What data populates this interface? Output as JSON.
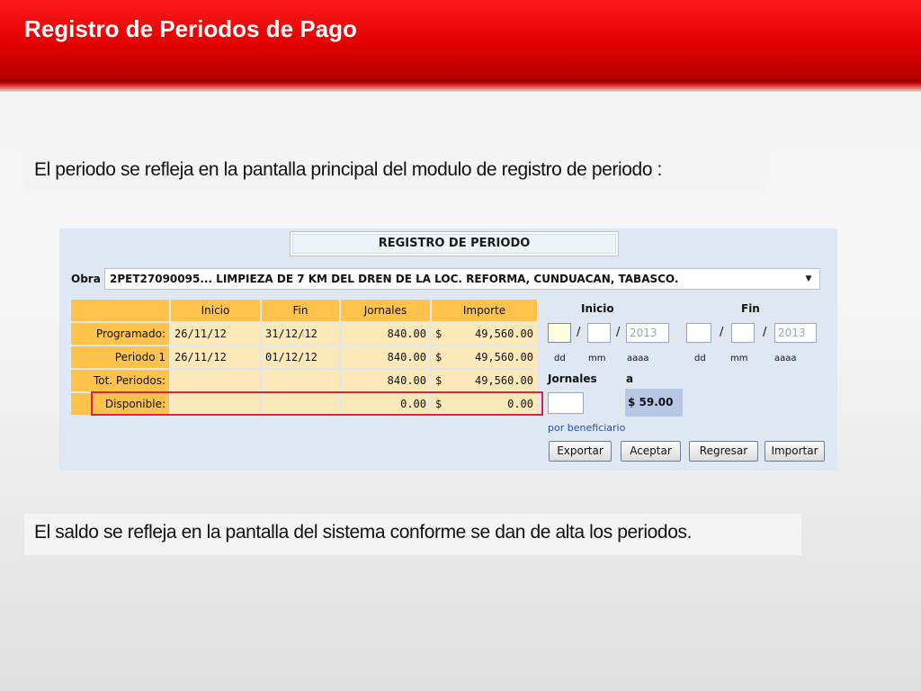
{
  "slide": {
    "title": "Registro de Periodos de Pago",
    "caption_top": "El periodo se refleja en la pantalla principal del modulo de registro de periodo :",
    "caption_bottom": "El saldo se refleja en la pantalla del sistema conforme se dan de alta los periodos."
  },
  "form": {
    "title": "REGISTRO DE PERIODO",
    "obra_label": "Obra",
    "obra_value": "2PET27090095... LIMPIEZA DE 7 KM DEL DREN DE LA LOC. REFORMA, CUNDUACAN, TABASCO.",
    "table": {
      "headers": [
        "Inicio",
        "Fin",
        "Jornales",
        "Importe"
      ],
      "rows": [
        {
          "label": "Programado:",
          "inicio": "26/11/12",
          "fin": "31/12/12",
          "jornales": "840.00",
          "currency": "$",
          "importe": "49,560.00"
        },
        {
          "label": "Periodo 1",
          "inicio": "26/11/12",
          "fin": "01/12/12",
          "jornales": "840.00",
          "currency": "$",
          "importe": "49,560.00"
        },
        {
          "label": "Tot. Periodos:",
          "inicio": "",
          "fin": "",
          "jornales": "840.00",
          "currency": "$",
          "importe": "49,560.00"
        },
        {
          "label": "Disponible:",
          "inicio": "",
          "fin": "",
          "jornales": "0.00",
          "currency": "$",
          "importe": "0.00"
        }
      ]
    },
    "inicio_label": "Inicio",
    "fin_label": "Fin",
    "year_placeholder": "2013",
    "sep": "/",
    "dd": "dd",
    "mm": "mm",
    "aaaa": "aaaa",
    "jornales_label": "Jornales",
    "a_label": "a",
    "importe_display": "$ 59.00",
    "link_text": "por beneficiario",
    "buttons": {
      "exportar": "Exportar",
      "aceptar": "Aceptar",
      "regresar": "Regresar",
      "importar": "Importar"
    },
    "colors": {
      "header_cells": "#ffc24a",
      "value_cells": "#fde9b8",
      "highlight_border": "#d7263d",
      "panel_bg": "#dfe7f3"
    }
  }
}
